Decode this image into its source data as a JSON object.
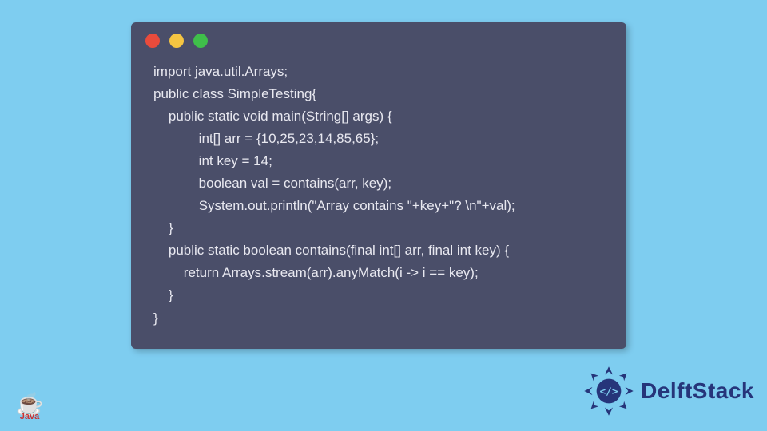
{
  "code": {
    "line1": "import java.util.Arrays;",
    "line2": "public class SimpleTesting{",
    "line3": "    public static void main(String[] args) {",
    "line4": "            int[] arr = {10,25,23,14,85,65};",
    "line5": "            int key = 14;",
    "line6": "            boolean val = contains(arr, key);",
    "line7": "            System.out.println(\"Array contains \"+key+\"? \\n\"+val);",
    "line8": "    }",
    "line9": "    public static boolean contains(final int[] arr, final int key) {",
    "line10": "        return Arrays.stream(arr).anyMatch(i -> i == key);",
    "line11": "    }",
    "line12": "}"
  },
  "logos": {
    "java_label": "Java",
    "delft_label": "DelftStack"
  },
  "window": {
    "dot_red": "close",
    "dot_yellow": "minimize",
    "dot_green": "zoom"
  }
}
